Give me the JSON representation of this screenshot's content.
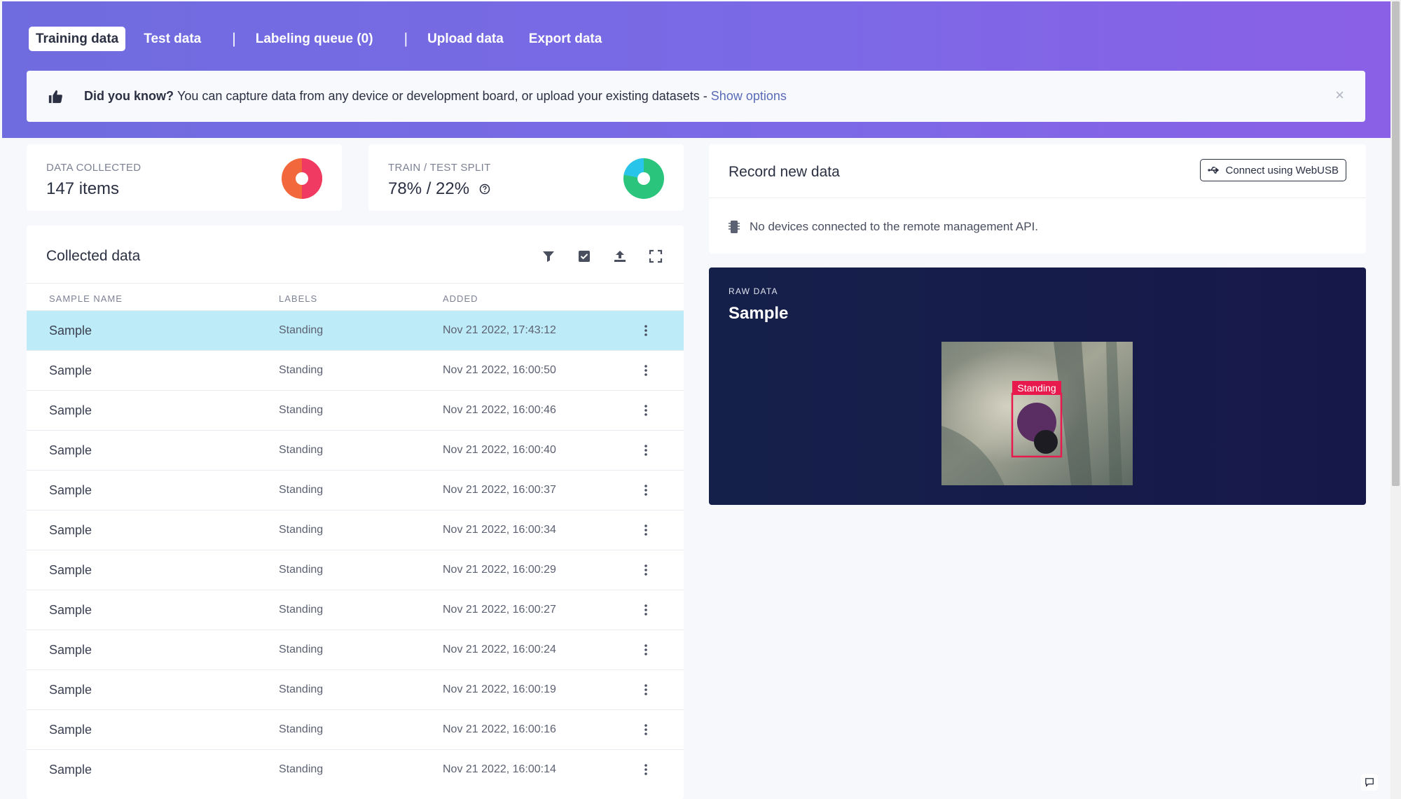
{
  "tabs": [
    {
      "label": "Training data",
      "active": true
    },
    {
      "label": "Test data",
      "active": false
    },
    {
      "label": "Labeling queue (0)",
      "active": false
    },
    {
      "label": "Upload data",
      "active": false
    },
    {
      "label": "Export data",
      "active": false
    }
  ],
  "tab_separator": "|",
  "banner": {
    "icon": "thumbs-up-icon",
    "bold": "Did you know?",
    "text": "You can capture data from any device or development board, or upload your existing datasets -",
    "link": "Show options",
    "close": "×"
  },
  "stats": {
    "collected": {
      "label": "DATA COLLECTED",
      "value": "147 items"
    },
    "split": {
      "label": "TRAIN / TEST SPLIT",
      "value": "78% / 22%",
      "train_fraction": 0.78
    }
  },
  "collected": {
    "title": "Collected data",
    "tools": [
      "filter-icon",
      "select-checkbox-icon",
      "upload-icon",
      "expand-icon"
    ],
    "columns": {
      "name": "SAMPLE NAME",
      "labels": "LABELS",
      "added": "ADDED"
    },
    "rows": [
      {
        "name": "Sample",
        "label": "Standing",
        "added": "Nov 21 2022, 17:43:12",
        "selected": true
      },
      {
        "name": "Sample",
        "label": "Standing",
        "added": "Nov 21 2022, 16:00:50"
      },
      {
        "name": "Sample",
        "label": "Standing",
        "added": "Nov 21 2022, 16:00:46"
      },
      {
        "name": "Sample",
        "label": "Standing",
        "added": "Nov 21 2022, 16:00:40"
      },
      {
        "name": "Sample",
        "label": "Standing",
        "added": "Nov 21 2022, 16:00:37"
      },
      {
        "name": "Sample",
        "label": "Standing",
        "added": "Nov 21 2022, 16:00:34"
      },
      {
        "name": "Sample",
        "label": "Standing",
        "added": "Nov 21 2022, 16:00:29"
      },
      {
        "name": "Sample",
        "label": "Standing",
        "added": "Nov 21 2022, 16:00:27"
      },
      {
        "name": "Sample",
        "label": "Standing",
        "added": "Nov 21 2022, 16:00:24"
      },
      {
        "name": "Sample",
        "label": "Standing",
        "added": "Nov 21 2022, 16:00:19"
      },
      {
        "name": "Sample",
        "label": "Standing",
        "added": "Nov 21 2022, 16:00:16"
      },
      {
        "name": "Sample",
        "label": "Standing",
        "added": "Nov 21 2022, 16:00:14"
      }
    ]
  },
  "record": {
    "title": "Record new data",
    "button": "Connect using WebUSB",
    "message": "No devices connected to the remote management API."
  },
  "raw": {
    "kicker": "RAW DATA",
    "title": "Sample",
    "bbox_label": "Standing"
  },
  "colors": {
    "accent": "#6f6cdf",
    "selected_row": "#bdebf7",
    "bbox": "#e8194d",
    "train": "#2bc47d",
    "test": "#29c4ea",
    "donut_orange": "#f2673b",
    "donut_pink": "#f13a61"
  }
}
